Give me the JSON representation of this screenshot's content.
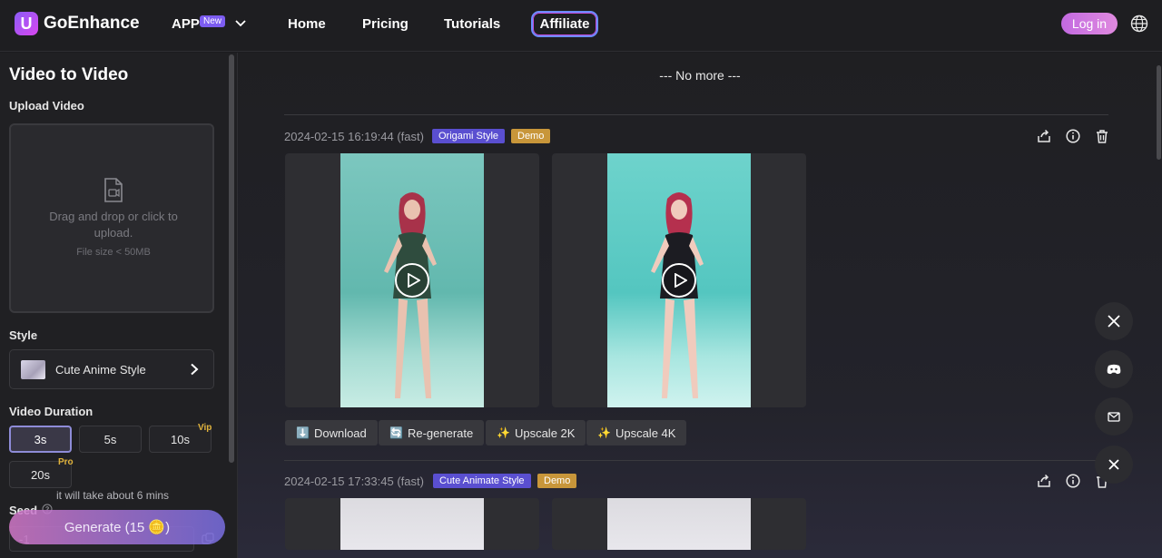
{
  "header": {
    "logo_text": "GoEnhance",
    "logo_letter": "U",
    "app_label": "APP",
    "app_badge": "New",
    "nav": [
      "Home",
      "Pricing",
      "Tutorials"
    ],
    "affiliate": "Affiliate",
    "login": "Log in"
  },
  "sidebar": {
    "title": "Video to Video",
    "upload_label": "Upload Video",
    "upload_text": "Drag and drop or click to upload.",
    "upload_size": "File size < 50MB",
    "style_label": "Style",
    "style_value": "Cute Anime Style",
    "duration_label": "Video Duration",
    "durations": [
      "3s",
      "5s",
      "10s",
      "20s"
    ],
    "vip_tag": "Vip",
    "pro_tag": "Pro",
    "time_note": "it will take about 6 mins",
    "seed_label": "Seed",
    "seed_value": "-1",
    "generate_label": "Generate (15 🪙)"
  },
  "main": {
    "no_more": "--- No more ---",
    "items": [
      {
        "time": "2024-02-15 16:19:44 (fast)",
        "style_tag": "Origami Style",
        "demo_tag": "Demo"
      },
      {
        "time": "2024-02-15 17:33:45 (fast)",
        "style_tag": "Cute Animate Style",
        "demo_tag": "Demo"
      }
    ],
    "actions": {
      "download": "Download",
      "regenerate": "Re-generate",
      "upscale2k": "Upscale 2K",
      "upscale4k": "Upscale 4K",
      "download_icon": "⬇️",
      "regenerate_icon": "🔄",
      "upscale_icon": "✨"
    }
  },
  "colors": {
    "accent": "#7c5cf0",
    "style_tag": "#5a4fd0",
    "demo_tag": "#c8963a",
    "vip": "#e0b23a"
  }
}
